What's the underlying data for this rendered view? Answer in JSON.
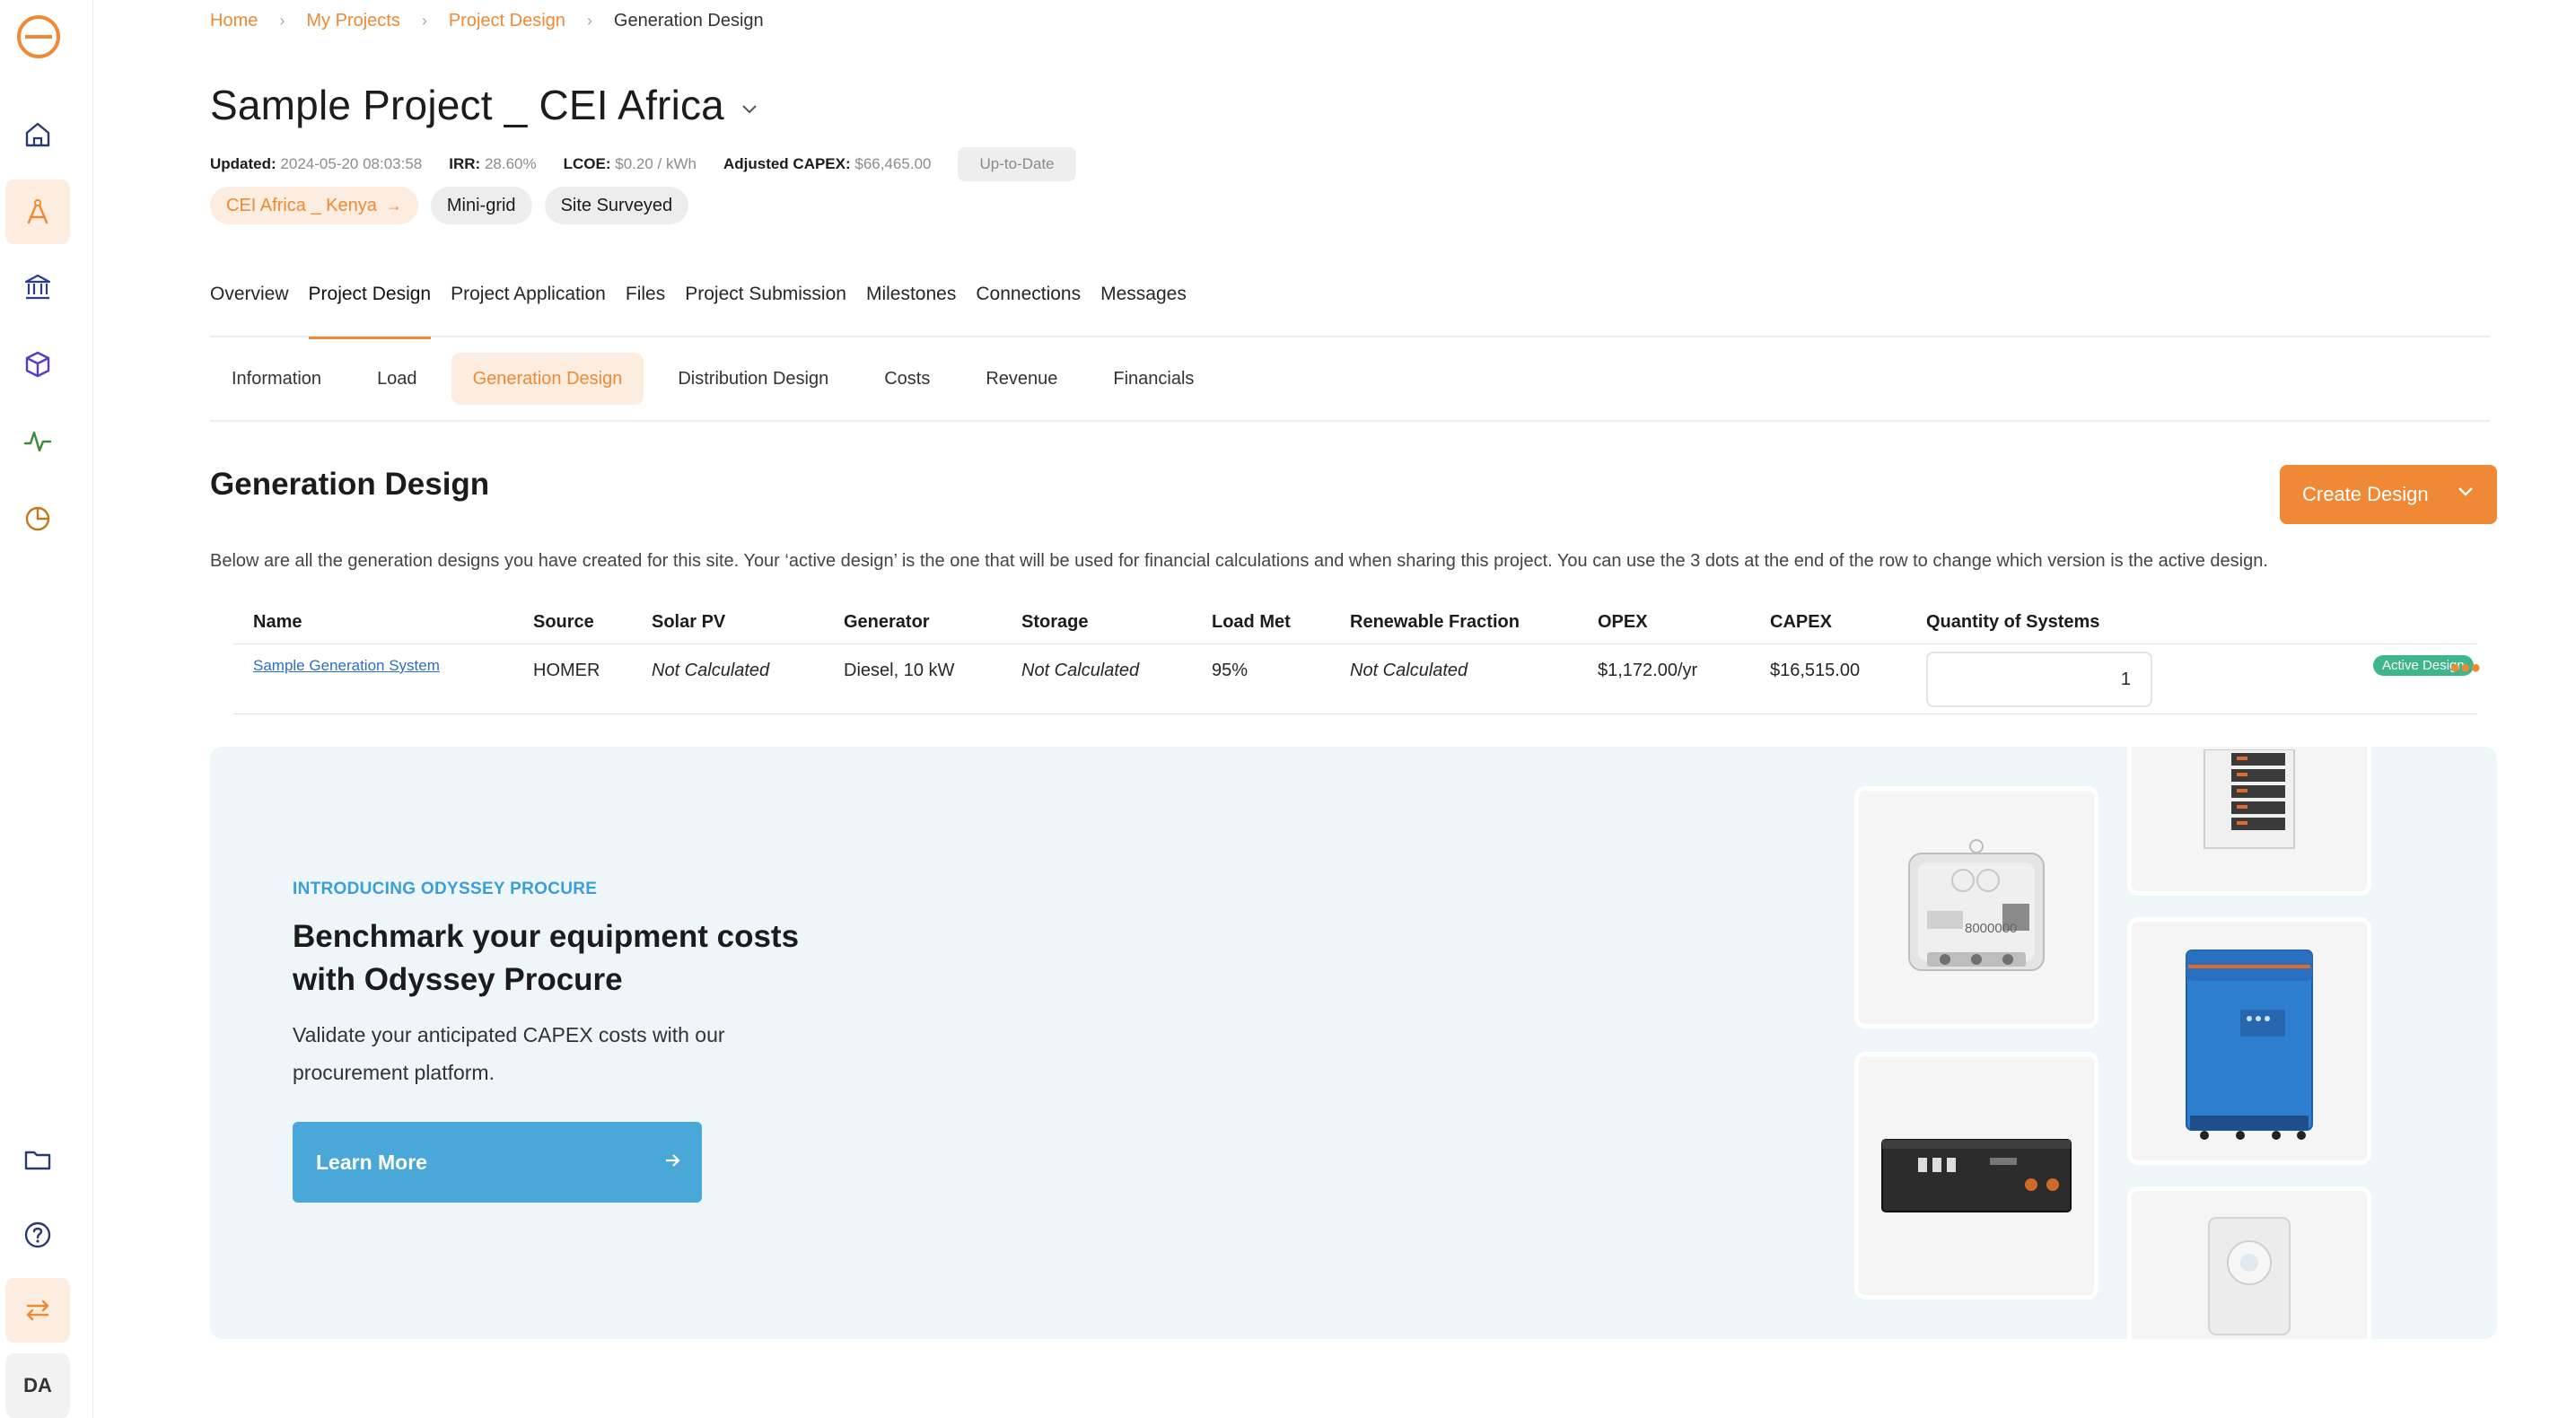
{
  "breadcrumb": [
    "Home",
    "My Projects",
    "Project Design",
    "Generation Design"
  ],
  "project": {
    "title": "Sample Project _ CEI Africa",
    "updated_label": "Updated:",
    "updated_value": "2024-05-20 08:03:58",
    "irr_label": "IRR:",
    "irr_value": "28.60%",
    "lcoe_label": "LCOE:",
    "lcoe_value": "$0.20 / kWh",
    "capex_label": "Adjusted CAPEX:",
    "capex_value": "$66,465.00",
    "status": "Up-to-Date",
    "tags": [
      "CEI Africa _ Kenya",
      "Mini-grid",
      "Site Surveyed"
    ]
  },
  "tabs": [
    "Overview",
    "Project Design",
    "Project Application",
    "Files",
    "Project Submission",
    "Milestones",
    "Connections",
    "Messages"
  ],
  "subtabs": [
    "Information",
    "Load",
    "Generation Design",
    "Distribution Design",
    "Costs",
    "Revenue",
    "Financials"
  ],
  "section": {
    "title": "Generation Design",
    "create_label": "Create Design",
    "description": "Below are all the generation designs you have created for this site. Your ‘active design’ is the one that will be used for financial calculations and when sharing this project. You can use the 3 dots at the end of the row to change which version is the active design."
  },
  "table": {
    "headers": [
      "Name",
      "Source",
      "Solar PV",
      "Generator",
      "Storage",
      "Load Met",
      "Renewable Fraction",
      "OPEX",
      "CAPEX",
      "Quantity of Systems"
    ],
    "row": {
      "name": "Sample Generation System",
      "source": "HOMER",
      "solar_pv": "Not Calculated",
      "generator": "Diesel, 10 kW",
      "storage": "Not Calculated",
      "load_met": "95%",
      "renewable_fraction": "Not Calculated",
      "opex": "$1,172.00/yr",
      "capex": "$16,515.00",
      "quantity": "1",
      "badge": "Active Design",
      "menu": "•••"
    }
  },
  "banner": {
    "kicker": "INTRODUCING ODYSSEY PROCURE",
    "title": "Benchmark your equipment costs with Odyssey Procure",
    "text": "Validate your anticipated CAPEX costs with our procurement platform.",
    "button": "Learn More",
    "meter_label": "8000000"
  },
  "user_initials": "DA",
  "colors": {
    "accent": "#ee8a34",
    "link": "#2a6fc7",
    "active_badge": "#3fb58b",
    "banner_bg": "#eef6fa",
    "learn_button": "#4aa8d8"
  }
}
